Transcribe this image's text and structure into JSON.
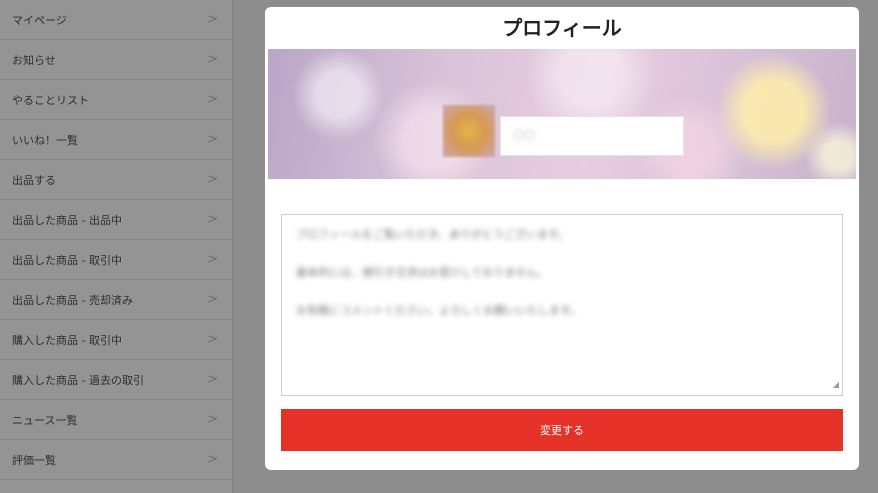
{
  "sidebar": {
    "items": [
      {
        "label": "マイページ"
      },
      {
        "label": "お知らせ"
      },
      {
        "label": "やることリスト"
      },
      {
        "label": "いいね！一覧"
      },
      {
        "label": "出品する"
      },
      {
        "label": "出品した商品 - 出品中"
      },
      {
        "label": "出品した商品 - 取引中"
      },
      {
        "label": "出品した商品 - 売却済み"
      },
      {
        "label": "購入した商品 - 取引中"
      },
      {
        "label": "購入した商品 - 過去の取引"
      },
      {
        "label": "ニュース一覧"
      },
      {
        "label": "評価一覧"
      }
    ],
    "chevron": ">"
  },
  "modal": {
    "title": "プロフィール",
    "name_value": "〇〇",
    "bio_lines": [
      "プロフィールをご覧いただき、ありがとうございます。",
      "基本的には、値引き交渉はお受けしておりません。",
      "お気軽にコメントください。よろしくお願いいたします。"
    ],
    "submit_label": "変更する"
  },
  "colors": {
    "accent": "#e53127",
    "overlay": "#8f8f8f"
  }
}
